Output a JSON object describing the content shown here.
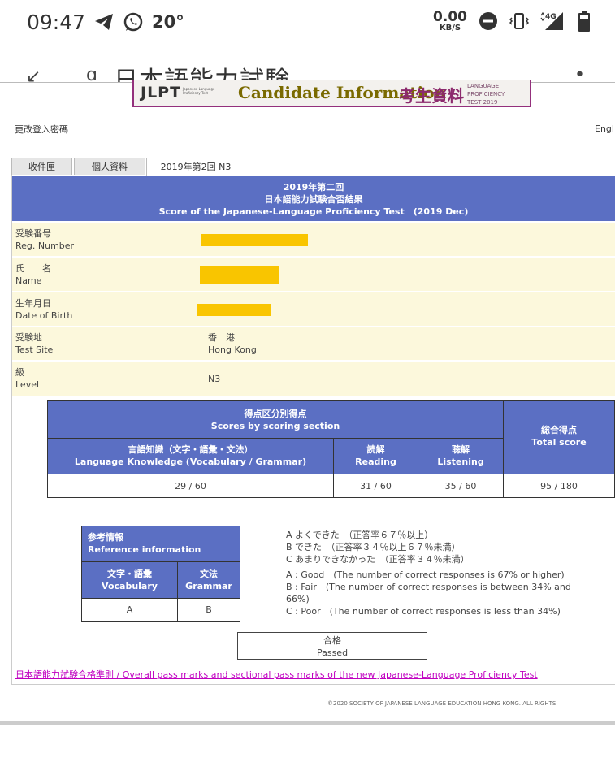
{
  "status_bar": {
    "time": "09:47",
    "temperature": "20°",
    "net_speed": "0.00",
    "net_unit": "KB/S",
    "network": "4G"
  },
  "app_bar": {
    "title": "日本語能力試験"
  },
  "banner": {
    "logo": "JLPT",
    "logo_sub": "Japanese-Language Proficiency Test",
    "title_en": "Candidate Information",
    "title_jp": "考生資料",
    "side_text": [
      "LANGUAGE",
      "PROFICIENCY",
      "TEST  2019"
    ]
  },
  "links": {
    "change_password": "更改登入密碼",
    "language": "Engli"
  },
  "tabs": [
    "收件匣",
    "個人資料",
    "2019年第2回 N3"
  ],
  "header": {
    "line1": "2019年第二回",
    "line2": "日本語能力試験合否結果",
    "line3": "Score of the Japanese-Language Proficiency Test　(2019 Dec)"
  },
  "info": {
    "reg_label_jp": "受験番号",
    "reg_label_en": "Reg. Number",
    "name_label_jp": "氏　　名",
    "name_label_en": "Name",
    "dob_label_jp": "生年月日",
    "dob_label_en": "Date of Birth",
    "site_label_jp": "受験地",
    "site_label_en": "Test Site",
    "site_value_jp": "香　港",
    "site_value_en": "Hong Kong",
    "level_label_jp": "級",
    "level_label_en": "Level",
    "level_value": "N3"
  },
  "scores": {
    "section_head_jp": "得点区分別得点",
    "section_head_en": "Scores by scoring section",
    "total_head_jp": "総合得点",
    "total_head_en": "Total score",
    "col1_jp": "言語知識（文字・語彙・文法）",
    "col1_en": "Language Knowledge (Vocabulary / Grammar)",
    "col2_jp": "読解",
    "col2_en": "Reading",
    "col3_jp": "聴解",
    "col3_en": "Listening",
    "val1": "29 / 60",
    "val2": "31 / 60",
    "val3": "35 / 60",
    "total": "95 / 180"
  },
  "reference": {
    "head_jp": "参考情報",
    "head_en": "Reference information",
    "col1_jp": "文字・語彙",
    "col1_en": "Vocabulary",
    "col2_jp": "文法",
    "col2_en": "Grammar",
    "val1": "A",
    "val2": "B"
  },
  "legend": {
    "l1": "A よくできた　（正答率６７％以上）",
    "l2": "B できた　（正答率３４％以上６７％未満）",
    "l3": "C あまりできなかった　（正答率３４％未満）",
    "l4": "A : Good　(The number of correct responses is 67% or higher)",
    "l5": "B : Fair　(The number of correct responses is between 34% and",
    "l6": "66%)",
    "l7": "C : Poor　(The number of correct responses is less than 34%)"
  },
  "result": {
    "jp": "合格",
    "en": "Passed"
  },
  "pass_marks_link": "日本語能力試験合格準則 / Overall pass marks and sectional pass marks of the new Japanese-Language Proficiency Test",
  "copyright": "©2020 SOCIETY OF JAPANESE LANGUAGE EDUCATION HONG KONG. ALL RIGHTS"
}
